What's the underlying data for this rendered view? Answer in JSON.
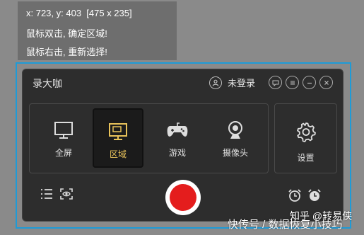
{
  "capture_info": {
    "coords": "x: 723, y: 403  [475 x 235]",
    "hint1": "鼠标双击, 确定区域!",
    "hint2": "鼠标右击, 重新选择!"
  },
  "app": {
    "title": "录大咖",
    "login_label": "未登录",
    "window_buttons": [
      "chat-icon",
      "menu-icon",
      "minimize-icon",
      "close-icon"
    ],
    "modes": [
      {
        "label": "全屏",
        "icon": "monitor-icon",
        "active": false
      },
      {
        "label": "区域",
        "icon": "region-icon",
        "active": true
      },
      {
        "label": "游戏",
        "icon": "gamepad-icon",
        "active": false
      },
      {
        "label": "摄像头",
        "icon": "webcam-icon",
        "active": false
      }
    ],
    "settings_label": "设置",
    "accent_color": "#e8c25a",
    "record_color": "#e41d1d",
    "selection_color": "#1e9bd7"
  },
  "watermark": {
    "top": "知乎 @转易侠",
    "bottom": "快传号 / 数据恢复小技巧"
  }
}
